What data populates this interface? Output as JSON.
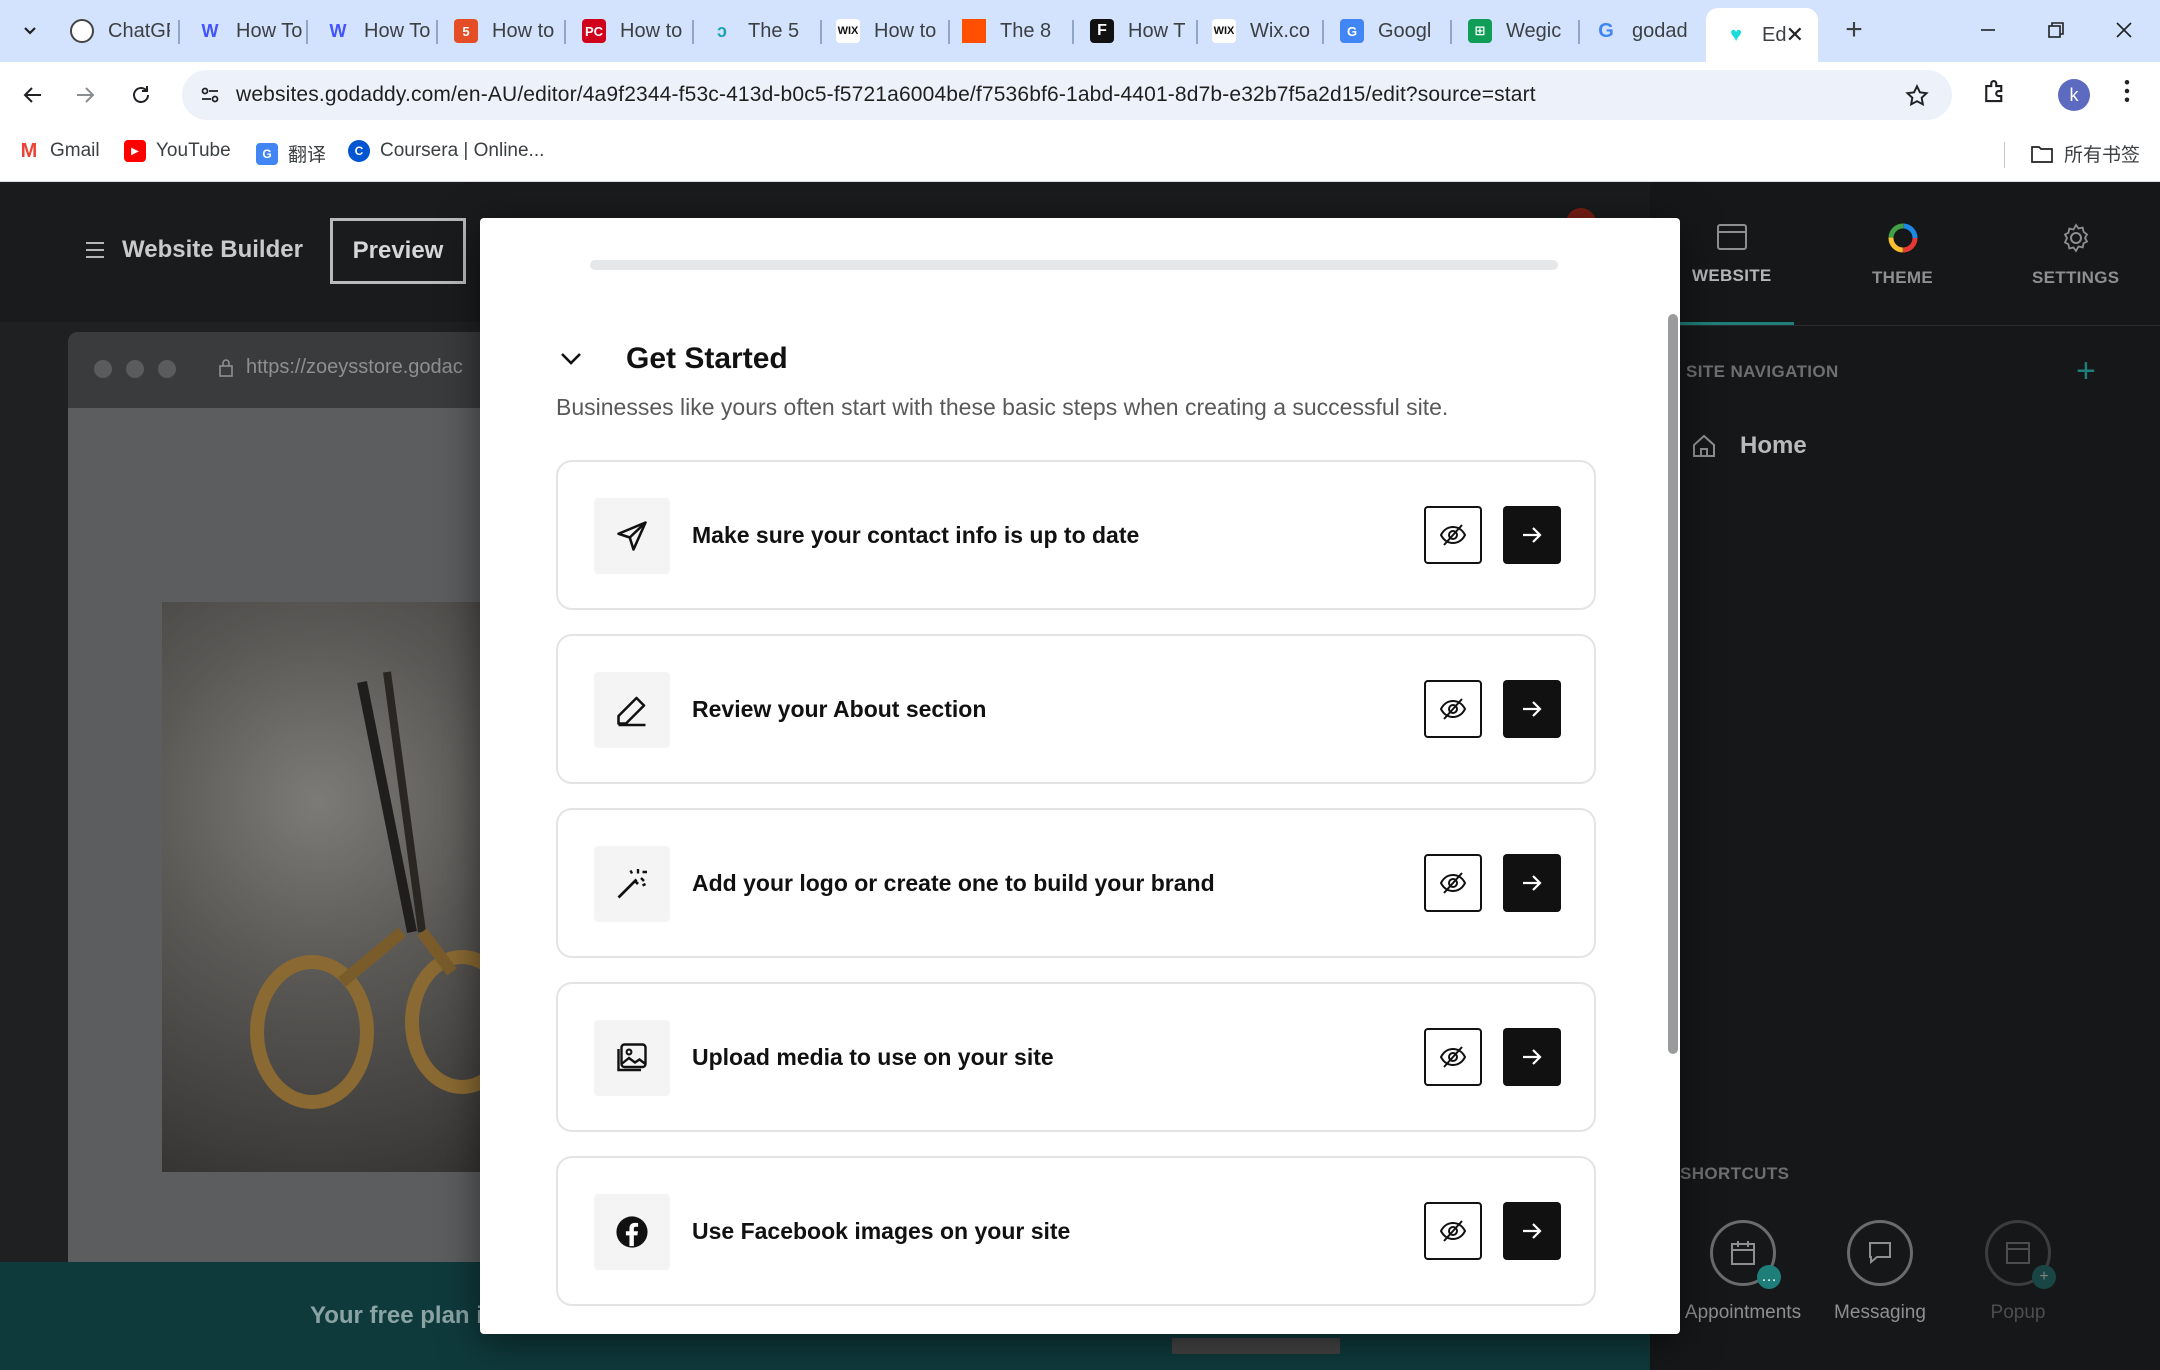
{
  "browser": {
    "tabs": [
      {
        "label": "ChatGPT",
        "icon": "openai-icon"
      },
      {
        "label": "How To",
        "icon": "webflow-icon"
      },
      {
        "label": "How To",
        "icon": "webflow-icon"
      },
      {
        "label": "How to",
        "icon": "html5-icon"
      },
      {
        "label": "How to",
        "icon": "pc-icon"
      },
      {
        "label": "The 5",
        "icon": "site-icon"
      },
      {
        "label": "How to",
        "icon": "wix-icon"
      },
      {
        "label": "The 8",
        "icon": "square-orange-icon"
      },
      {
        "label": "How T",
        "icon": "f-icon"
      },
      {
        "label": "Wix.co",
        "icon": "wix-icon"
      },
      {
        "label": "Googl",
        "icon": "translate-icon"
      },
      {
        "label": "Wegic",
        "icon": "sheets-icon"
      },
      {
        "label": "godad",
        "icon": "google-icon"
      },
      {
        "label": "Ed",
        "icon": "godaddy-icon"
      }
    ],
    "url": "websites.godaddy.com/en-AU/editor/4a9f2344-f53c-413d-b0c5-f5721a6004be/f7536bf6-1abd-4401-8d7b-e32b7f5a2d15/edit?source=start",
    "avatar_letter": "k",
    "bookmarks": [
      {
        "label": "Gmail"
      },
      {
        "label": "YouTube"
      },
      {
        "label": "翻译"
      },
      {
        "label": "Coursera | Online..."
      }
    ],
    "all_bookmarks": "所有书签"
  },
  "editor": {
    "title": "Website Builder",
    "preview_label": "Preview",
    "frame_url": "https://zoeysstore.godac",
    "free_plan_text": "Your free plan i",
    "sidebar": {
      "tabs": [
        {
          "label": "WEBSITE"
        },
        {
          "label": "THEME"
        },
        {
          "label": "SETTINGS"
        }
      ],
      "site_navigation": "SITE NAVIGATION",
      "home": "Home",
      "shortcuts_title": "SHORTCUTS",
      "shortcuts": [
        {
          "label": "Appointments"
        },
        {
          "label": "Messaging"
        },
        {
          "label": "Popup"
        }
      ]
    }
  },
  "modal": {
    "section_title": "Get Started",
    "section_desc": "Businesses like yours often start with these basic steps when creating a successful site.",
    "tasks": [
      {
        "label": "Make sure your contact info is up to date",
        "icon": "send-icon"
      },
      {
        "label": "Review your About section",
        "icon": "pencil-icon"
      },
      {
        "label": "Add your logo or create one to build your brand",
        "icon": "magic-wand-icon"
      },
      {
        "label": "Upload media to use on your site",
        "icon": "image-gallery-icon"
      },
      {
        "label": "Use Facebook images on your site",
        "icon": "facebook-icon"
      }
    ]
  },
  "colors": {
    "accent_teal": "#1e7f7a",
    "tabstrip": "#d3e3fd",
    "dark_button": "#111111"
  }
}
